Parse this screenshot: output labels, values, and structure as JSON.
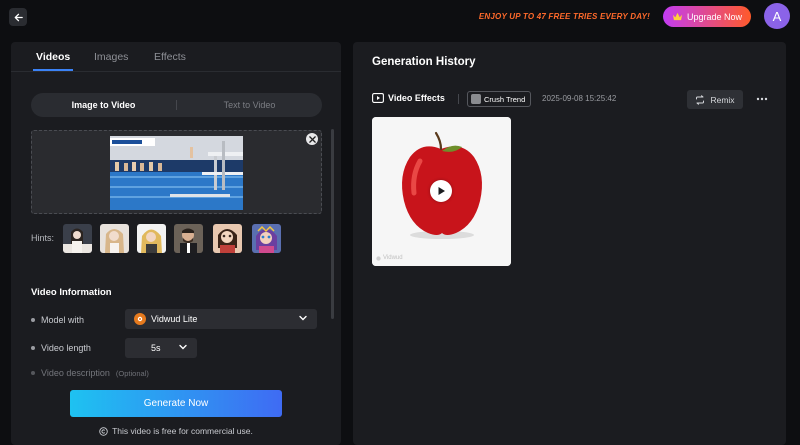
{
  "topbar": {
    "promo_text": "ENJOY UP TO 47 FREE TRIES EVERY DAY!",
    "upgrade_label": "Upgrade Now",
    "avatar_initial": "A"
  },
  "left": {
    "tabs": [
      {
        "label": "Videos",
        "active": true
      },
      {
        "label": "Images",
        "active": false
      },
      {
        "label": "Effects",
        "active": false
      }
    ],
    "segments": [
      {
        "label": "Image to Video",
        "active": true
      },
      {
        "label": "Text to Video",
        "active": false
      }
    ],
    "hints_label": "Hints:",
    "section_title": "Video Information",
    "model_label": "Model with",
    "model_value": "Vidwud Lite",
    "length_label": "Video length",
    "length_value": "5s",
    "description_label": "Video description",
    "description_optional": "(Optional)",
    "generate_label": "Generate Now",
    "commercial_note": "This video is free for commercial use."
  },
  "right": {
    "title": "Generation History",
    "effect_label": "Video Effects",
    "trend_label": "Crush Trend",
    "timestamp": "2025-09-08 15:25:42",
    "remix_label": "Remix"
  },
  "colors": {
    "accent": "#3b82f6",
    "promo": "#ff6a2b",
    "generate_start": "#1ec2f1",
    "generate_end": "#3f6bf3"
  }
}
